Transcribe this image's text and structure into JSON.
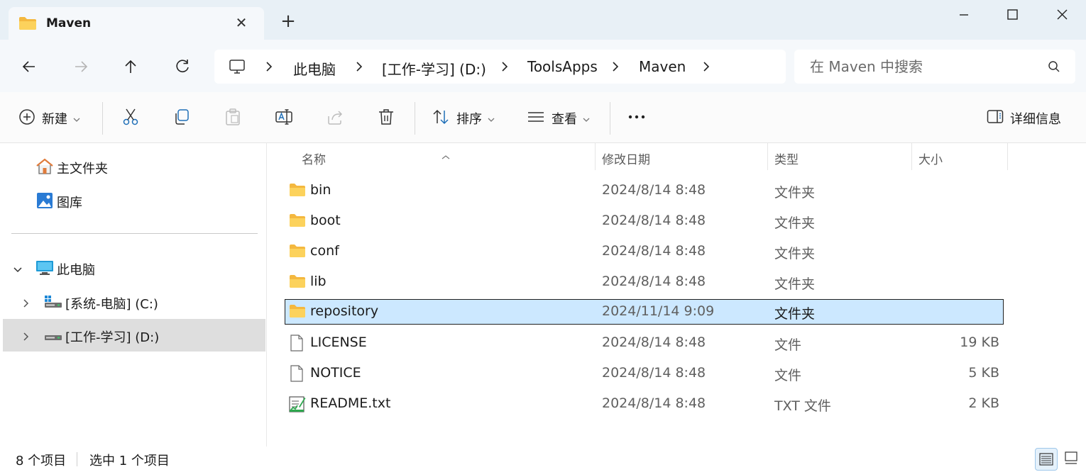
{
  "tab": {
    "title": "Maven"
  },
  "address": {
    "crumbs": [
      "此电脑",
      "[工作-学习] (D:)",
      "ToolsApps",
      "Maven"
    ]
  },
  "search": {
    "placeholder": "在 Maven 中搜索"
  },
  "commands": {
    "new": "新建",
    "sort": "排序",
    "view": "查看",
    "details": "详细信息"
  },
  "sidebar": {
    "items": [
      {
        "label": "主文件夹",
        "icon": "home-icon"
      },
      {
        "label": "图库",
        "icon": "gallery-icon"
      },
      {
        "label": "此电脑",
        "icon": "computer-icon"
      },
      {
        "label": "[系统-电脑] (C:)",
        "icon": "drive-icon"
      },
      {
        "label": "[工作-学习] (D:)",
        "icon": "drive-icon"
      }
    ]
  },
  "columns": {
    "name": "名称",
    "modified": "修改日期",
    "type": "类型",
    "size": "大小"
  },
  "files": [
    {
      "name": "bin",
      "modified": "2024/8/14 8:48",
      "type": "文件夹",
      "size": "",
      "icon": "folder-icon"
    },
    {
      "name": "boot",
      "modified": "2024/8/14 8:48",
      "type": "文件夹",
      "size": "",
      "icon": "folder-icon"
    },
    {
      "name": "conf",
      "modified": "2024/8/14 8:48",
      "type": "文件夹",
      "size": "",
      "icon": "folder-icon"
    },
    {
      "name": "lib",
      "modified": "2024/8/14 8:48",
      "type": "文件夹",
      "size": "",
      "icon": "folder-icon"
    },
    {
      "name": "repository",
      "modified": "2024/11/14 9:09",
      "type": "文件夹",
      "size": "",
      "icon": "folder-icon"
    },
    {
      "name": "LICENSE",
      "modified": "2024/8/14 8:48",
      "type": "文件",
      "size": "19 KB",
      "icon": "file-icon"
    },
    {
      "name": "NOTICE",
      "modified": "2024/8/14 8:48",
      "type": "文件",
      "size": "5 KB",
      "icon": "file-icon"
    },
    {
      "name": "README.txt",
      "modified": "2024/8/14 8:48",
      "type": "TXT 文件",
      "size": "2 KB",
      "icon": "text-file-icon"
    }
  ],
  "status": {
    "count": "8 个项目",
    "selected": "选中 1 个项目"
  },
  "colors": {
    "accent": "#0067c0",
    "selection": "#cce8ff",
    "folder": "#f7c948",
    "titlebar": "#e8f0f6"
  }
}
